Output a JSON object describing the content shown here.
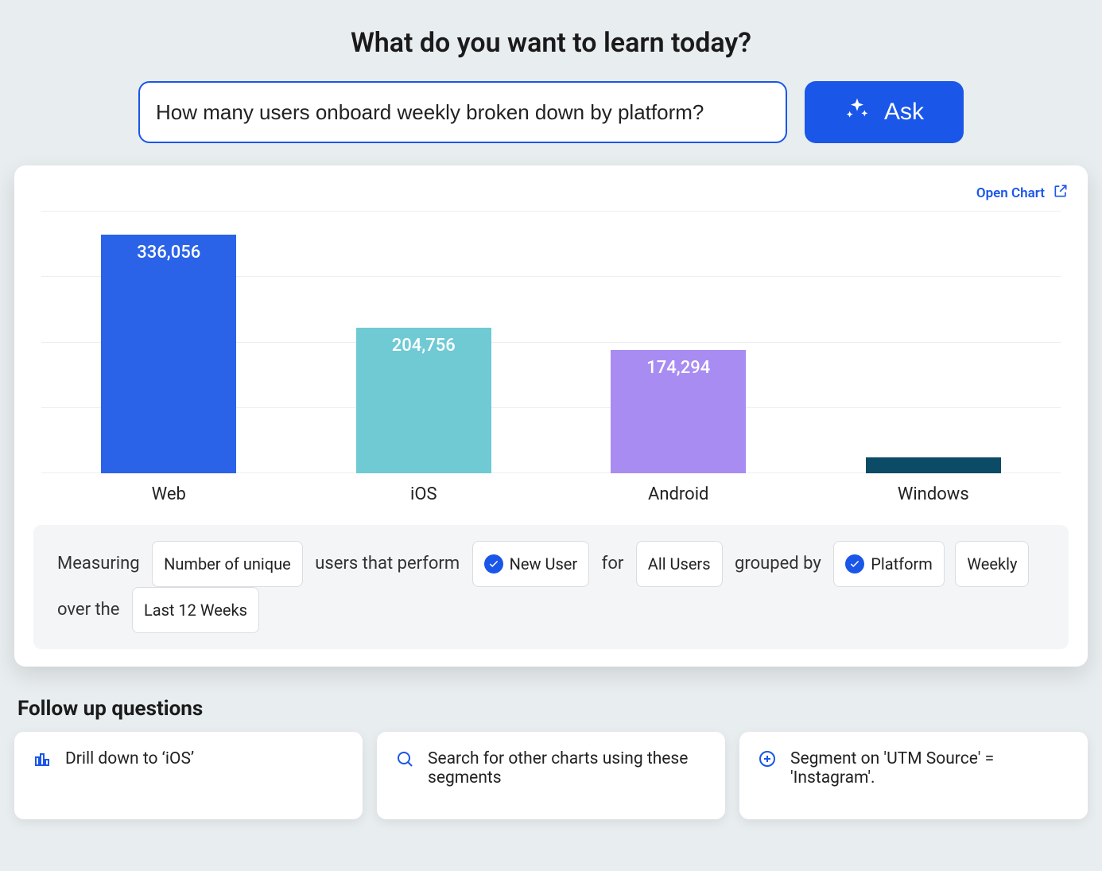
{
  "heading": "What do you want to learn today?",
  "search": {
    "value": "How many users onboard weekly broken down by platform?",
    "ask_label": "Ask"
  },
  "open_chart_label": "Open Chart",
  "chart_data": {
    "type": "bar",
    "categories": [
      "Web",
      "iOS",
      "Android",
      "Windows"
    ],
    "values": [
      336056,
      204756,
      174294,
      22000
    ],
    "value_labels": [
      "336,056",
      "204,756",
      "174,294",
      ""
    ],
    "series": [
      {
        "name": "Web",
        "color": "#2a63e8"
      },
      {
        "name": "iOS",
        "color": "#6fcad4"
      },
      {
        "name": "Android",
        "color": "#a88cf2"
      },
      {
        "name": "Windows",
        "color": "#0b4b66"
      }
    ],
    "title": "",
    "xlabel": "",
    "ylabel": "",
    "ylim": [
      0,
      370000
    ],
    "gridlines": 5
  },
  "formula": {
    "t1": "Measuring",
    "chip_measure": "Number of unique",
    "t2": "users that perform",
    "chip_event": "New User",
    "t3": "for",
    "chip_cohort": "All Users",
    "t4": "grouped by",
    "chip_group": "Platform",
    "chip_interval": "Weekly",
    "t5": "over the",
    "chip_range": "Last 12 Weeks"
  },
  "followup_heading": "Follow up questions",
  "followups": [
    {
      "icon": "bar-chart-icon",
      "text": "Drill down to ‘iOS’"
    },
    {
      "icon": "search-icon",
      "text": "Search for other charts using these segments"
    },
    {
      "icon": "plus-circle-icon",
      "text": "Segment on 'UTM Source' = 'Instagram'."
    }
  ]
}
